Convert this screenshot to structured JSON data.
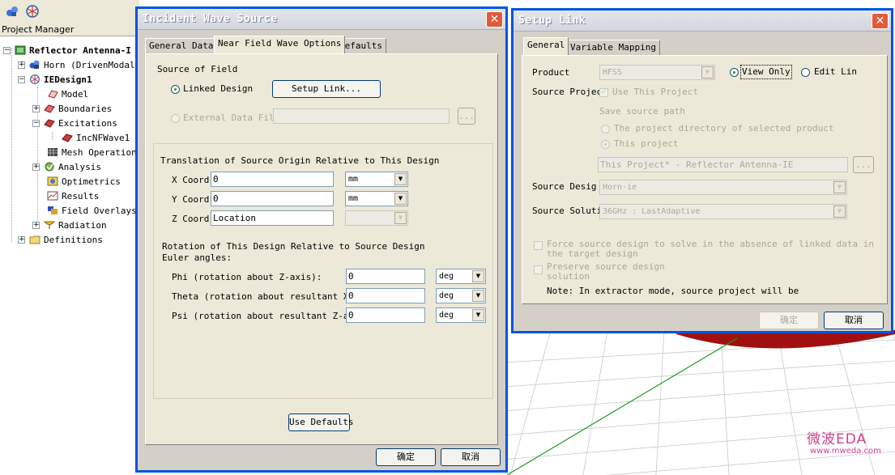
{
  "project_manager": {
    "title": "Project Manager",
    "toolbar_icons": [
      "models-icon",
      "ie-design-icon"
    ],
    "tree": {
      "root": "Reflector Antenna-I",
      "horn": "Horn (DrivenModal)",
      "design": "IEDesign1",
      "model": "Model",
      "boundaries": "Boundaries",
      "excitations": "Excitations",
      "excitation_child": "IncNFWave1",
      "mesh": "Mesh Operations",
      "analysis": "Analysis",
      "optimetrics": "Optimetrics",
      "results": "Results",
      "field_overlays": "Field Overlays",
      "radiation": "Radiation",
      "definitions": "Definitions"
    }
  },
  "incident_dialog": {
    "title": "Incident Wave Source",
    "tabs": [
      "General Data",
      "Near Field Wave Options",
      "Defaults"
    ],
    "source_of_field": "Source of Field",
    "linked_design": "Linked Design",
    "setup_link_button": "Setup Link...",
    "external_data_file": "External Data File",
    "external_file_value": "",
    "browse_button": "...",
    "translation_header": "Translation of Source Origin Relative to This Design",
    "x_label": "X Coord",
    "x_value": "0",
    "x_unit": "mm",
    "y_label": "Y Coord",
    "y_value": "0",
    "y_unit": "mm",
    "z_label": "Z Coord",
    "z_value": "Location",
    "z_unit": "",
    "rotation_header": "Rotation of This Design Relative to Source Design",
    "euler_label": "Euler angles:",
    "phi_label": "Phi (rotation about Z-axis):",
    "phi_value": "0",
    "phi_unit": "deg",
    "theta_label": "Theta (rotation about resultant X-ax",
    "theta_value": "0",
    "theta_unit": "deg",
    "psi_label": "Psi (rotation about resultant Z-axis",
    "psi_value": "0",
    "psi_unit": "deg",
    "use_defaults_button": "Use Defaults",
    "ok_button": "确定",
    "cancel_button": "取消"
  },
  "setup_dialog": {
    "title": "Setup Link",
    "tabs": [
      "General",
      "Variable Mapping"
    ],
    "product_label": "Product",
    "product_value": "HFSS",
    "view_only": "View Only",
    "edit_link": "Edit Lin",
    "source_project_label": "Source Projec",
    "use_this_project": "Use This Project",
    "save_source_path": "Save source path",
    "project_dir_option": "The project directory of selected product",
    "this_project_option": "This project",
    "project_path_value": "This Project* - Reflector Antenna-IE",
    "browse_button": "...",
    "source_design_label": "Source Desig",
    "source_design_value": "Horn-ie",
    "source_solution_label": "Source Soluti",
    "source_solution_value": "36GHz : LastAdaptive",
    "force_solve_line1": "Force source design to solve in the absence of linked data in",
    "force_solve_line2": "the target design",
    "preserve_line1": "Preserve source design",
    "preserve_line2": "solution",
    "note": "Note: In extractor mode, source project will be",
    "ok_button": "确定",
    "cancel_button": "取消"
  },
  "watermark": {
    "title": "微波EDA",
    "url": "www.mweda.com"
  },
  "colors": {
    "dialog_border": "#0054e3",
    "close_button": "#e35a3a",
    "panel_bg": "#ece9d8",
    "reflector_red": "#a01010",
    "axis_green": "#1f9a1f",
    "watermark_pink": "#d0408a"
  }
}
